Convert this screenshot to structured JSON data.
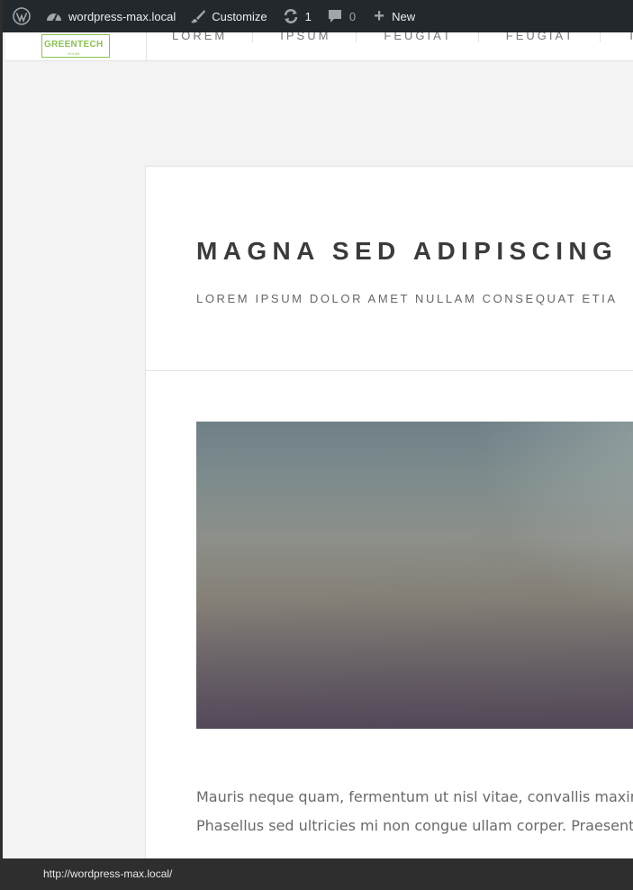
{
  "adminbar": {
    "site_name": "wordpress-max.local",
    "customize_label": "Customize",
    "updates_count": "1",
    "comments_count": "0",
    "new_label": "New",
    "icons": [
      "wordpress-logo-icon",
      "dashboard-icon",
      "brush-icon",
      "update-icon",
      "comment-icon",
      "plus-icon"
    ]
  },
  "header": {
    "logo_text": "GREENTECH",
    "logo_sub": "SOLAR",
    "nav": [
      "LOREM",
      "IPSUM",
      "FEUGIAT",
      "FEUGIAT",
      "TEMPUS"
    ]
  },
  "post": {
    "title": "MAGNA SED ADIPISCING",
    "subtitle": "LOREM IPSUM DOLOR AMET NULLAM CONSEQUAT ETIA",
    "body_line1": "Mauris neque quam, fermentum ut nisl vitae, convallis maximu",
    "body_line2": "Phasellus sed ultricies mi non congue ullam corper. Praesent tir"
  },
  "statusbar": {
    "url": "http://wordpress-max.local/"
  },
  "colors": {
    "adminbar_bg": "#23282d",
    "brand_green": "#8cc152",
    "title_color": "#3c3b3b"
  }
}
